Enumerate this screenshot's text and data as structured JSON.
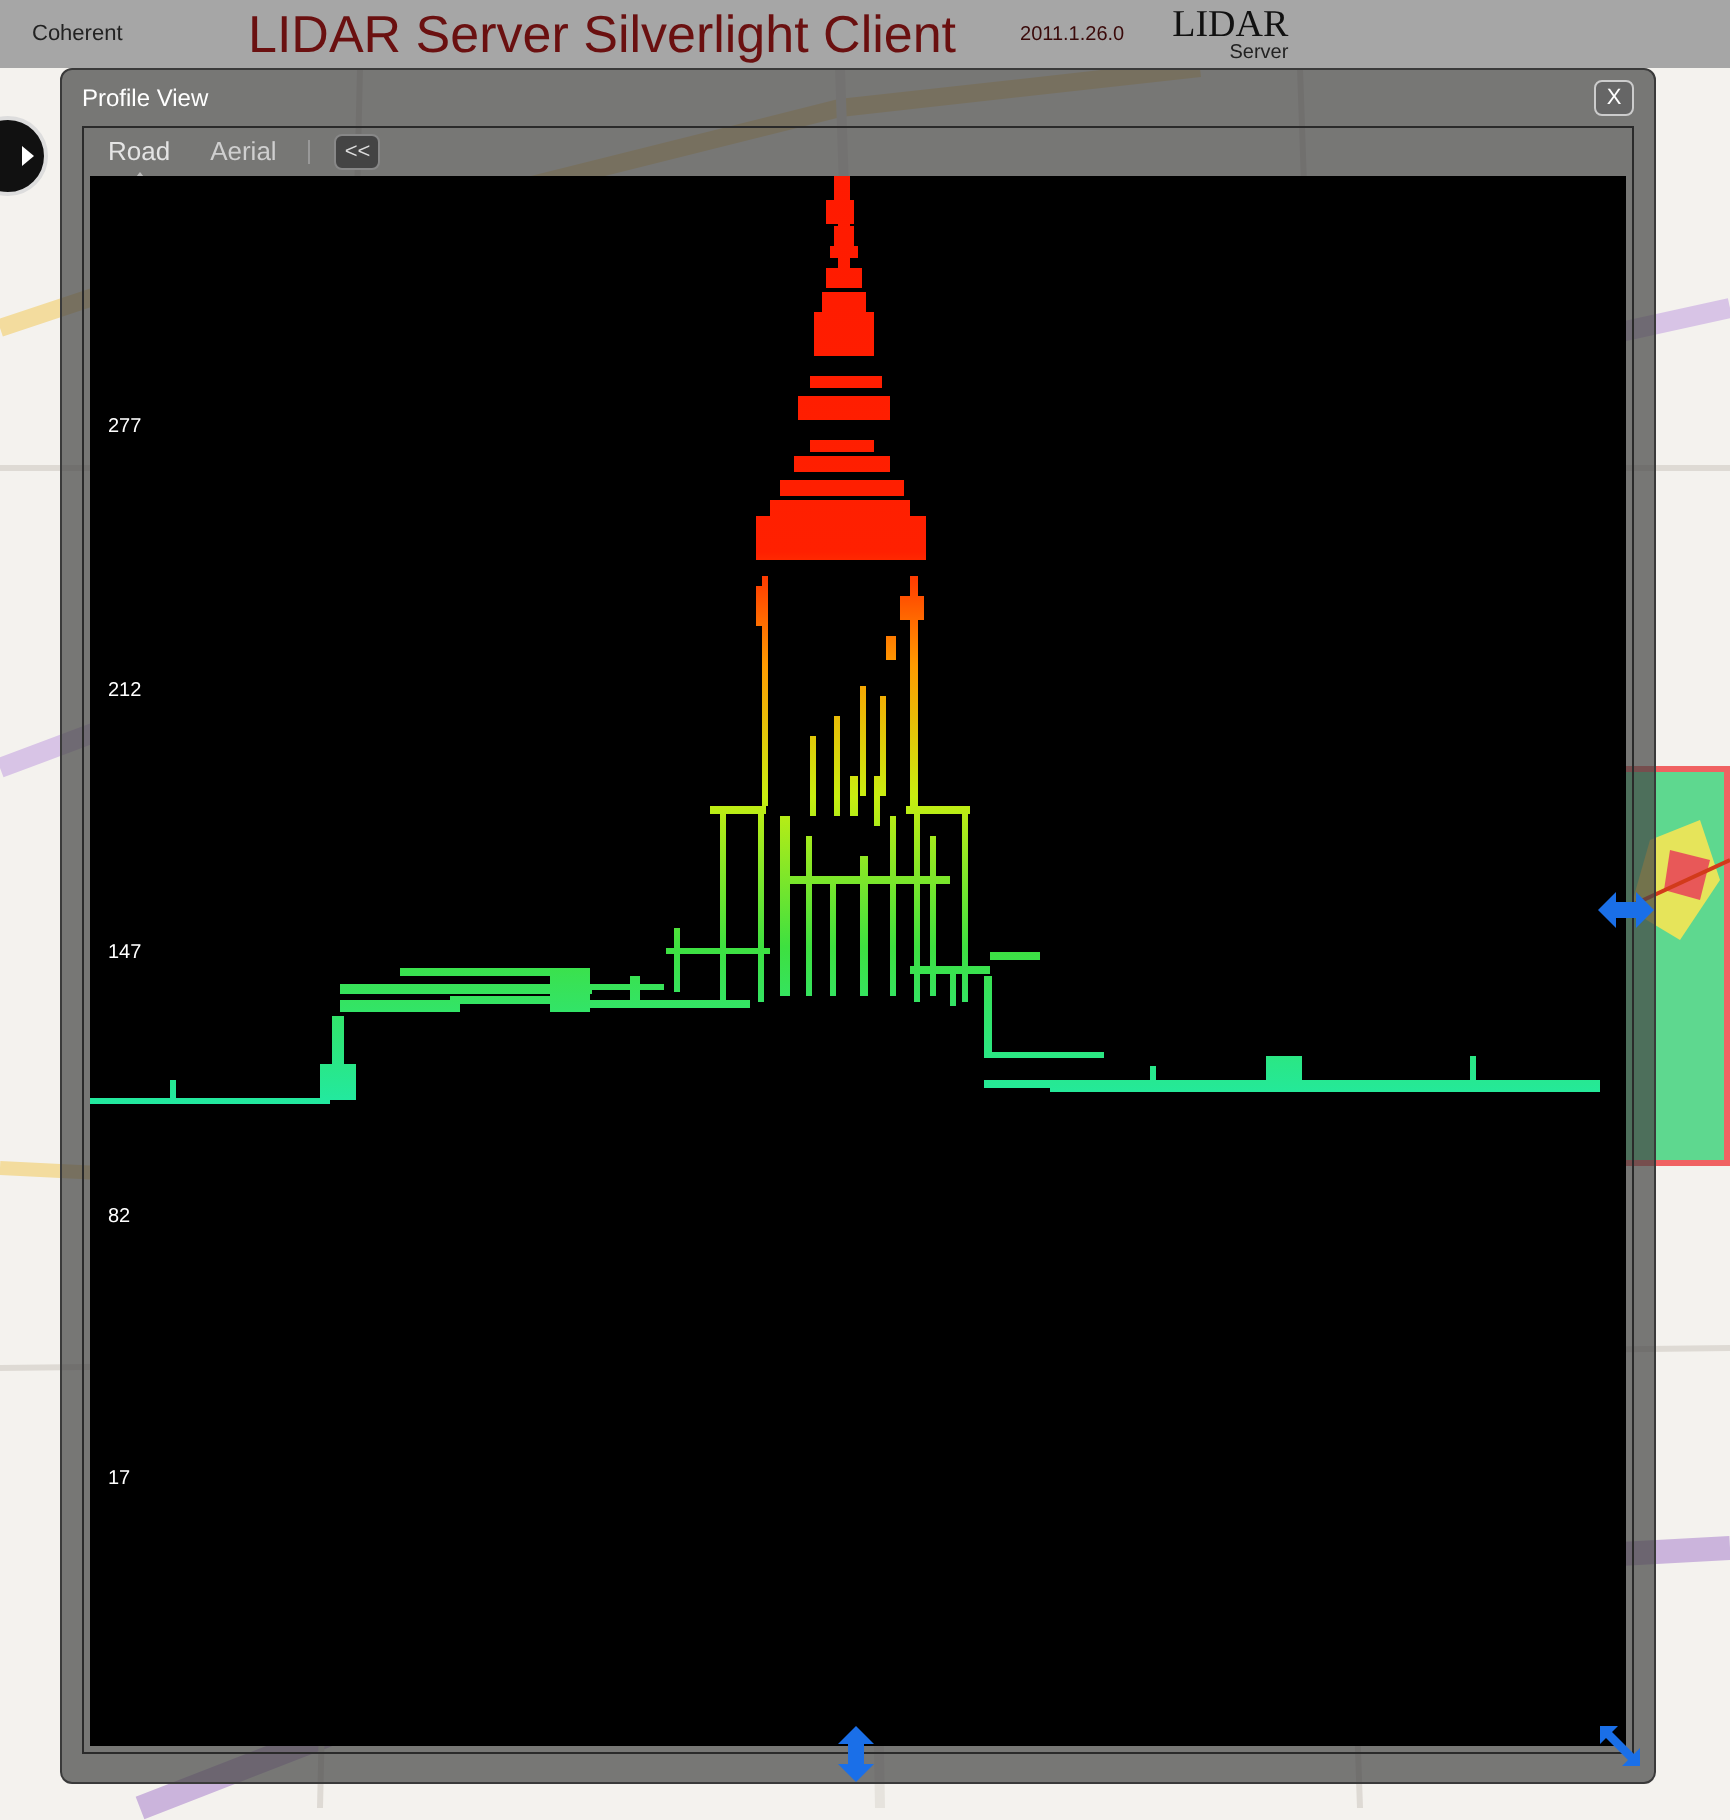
{
  "header": {
    "logo_text": "Coherent",
    "title": "LIDAR Server Silverlight Client",
    "version": "2011.1.26.0",
    "brand_logo": {
      "line1": "LIDAR",
      "line2": "Server"
    }
  },
  "map_type_buttons": [
    {
      "label": "Road",
      "selected": true
    },
    {
      "label": "Aerial",
      "selected": false
    }
  ],
  "collapse_button": "<<",
  "dialog": {
    "title": "Profile View",
    "close_label": "X",
    "y_axis_labels": [
      "277",
      "212",
      "147",
      "82",
      "17"
    ]
  }
}
